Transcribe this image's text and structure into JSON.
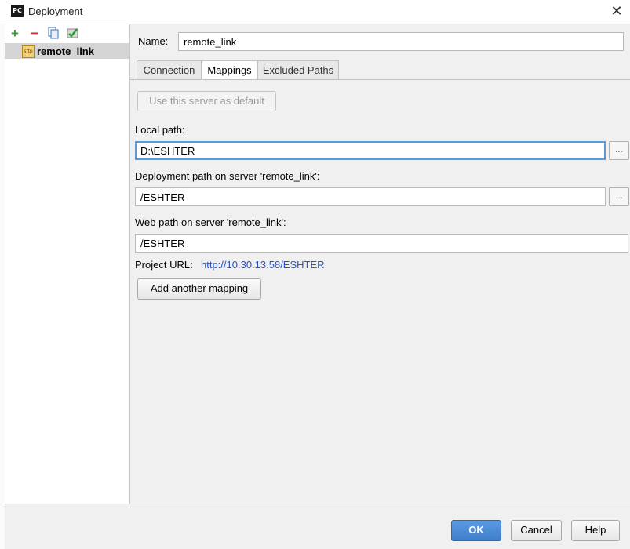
{
  "window": {
    "title": "Deployment",
    "app_icon_text": "PC"
  },
  "toolbar": {
    "add": "+",
    "remove": "−",
    "copy": "❐",
    "check": "✔"
  },
  "servers": [
    {
      "label": "remote_link",
      "icon_text": "sftp",
      "selected": true
    }
  ],
  "name": {
    "label": "Name:",
    "value": "remote_link"
  },
  "tabs": [
    {
      "label": "Connection",
      "active": false
    },
    {
      "label": "Mappings",
      "active": true
    },
    {
      "label": "Excluded Paths",
      "active": false
    }
  ],
  "mappings": {
    "default_button": "Use this server as default",
    "local_path_label": "Local path:",
    "local_path_value": "D:\\ESHTER",
    "deployment_path_label": "Deployment path on server 'remote_link':",
    "deployment_path_value": "/ESHTER",
    "web_path_label": "Web path on server 'remote_link':",
    "web_path_value": "/ESHTER",
    "project_url_label": "Project URL:",
    "project_url_value": "http://10.30.13.58/ESHTER",
    "browse_label": "...",
    "add_mapping_button": "Add another mapping"
  },
  "buttons": {
    "ok": "OK",
    "cancel": "Cancel",
    "help": "Help"
  },
  "colors": {
    "accent": "#4a8bd8",
    "link": "#2255cc",
    "focus": "#5b9ad6"
  }
}
